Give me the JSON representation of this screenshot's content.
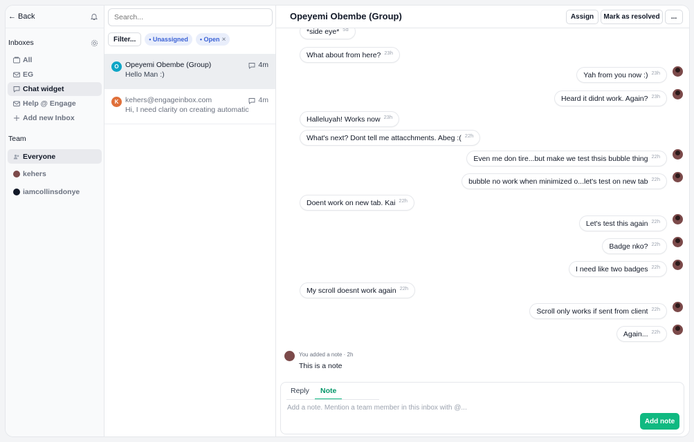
{
  "sidebar": {
    "back_label": "← Back",
    "inboxes_heading": "Inboxes",
    "inbox_items": [
      {
        "label": "All",
        "icon": "inbox-stack-icon"
      },
      {
        "label": "EG",
        "icon": "mail-icon"
      },
      {
        "label": "Chat widget",
        "icon": "chat-icon",
        "active": true
      },
      {
        "label": "Help @ Engage",
        "icon": "mail-icon"
      },
      {
        "label": "Add new Inbox",
        "icon": "plus-icon"
      }
    ],
    "team_heading": "Team",
    "team_items": [
      {
        "label": "Everyone",
        "icon": "users-icon",
        "active": true
      },
      {
        "label": "kehers",
        "icon": "avatar"
      },
      {
        "label": "iamcollinsdonye",
        "icon": "avatar"
      }
    ]
  },
  "conversations": {
    "search_placeholder": "Search...",
    "filter_label": "Filter...",
    "chips": [
      "• Unassigned",
      "• Open"
    ],
    "chip_close": "×",
    "items": [
      {
        "initial": "O",
        "name": "Opeyemi Obembe (Group)",
        "preview": "Hello Man :)",
        "time": "4m",
        "color": "#0ea5c6"
      },
      {
        "initial": "K",
        "name": "kehers@engageinbox.com",
        "preview": "Hi, I need clarity on creating automations",
        "time": "4m",
        "color": "#e0703a"
      }
    ]
  },
  "main": {
    "title": "Opeyemi Obembe (Group)",
    "assign_label": "Assign",
    "resolve_label": "Mark as resolved",
    "more_label": "...",
    "messages": [
      {
        "dir": "in",
        "text": "*side eye*",
        "time": "5d"
      },
      {
        "dir": "in",
        "text": "What about from here?",
        "time": "23h"
      },
      {
        "dir": "out",
        "text": "Yah from you now :)",
        "time": "23h"
      },
      {
        "dir": "out",
        "text": "Heard it didnt work. Again?",
        "time": "23h"
      },
      {
        "dir": "in",
        "text": "Halleluyah! Works now",
        "time": "23h"
      },
      {
        "dir": "in",
        "text": "What's next? Dont tell me attacchments. Abeg :(",
        "time": "22h"
      },
      {
        "dir": "out",
        "text": "Even me don tire...but make we test thsis bubble thing",
        "time": "22h"
      },
      {
        "dir": "out",
        "text": "bubble no work when minimized o...let's test on new tab",
        "time": "22h"
      },
      {
        "dir": "in",
        "text": "Doent work on new tab. Kai",
        "time": "22h"
      },
      {
        "dir": "out",
        "text": "Let's test this again",
        "time": "22h"
      },
      {
        "dir": "out",
        "text": "Badge nko?",
        "time": "22h"
      },
      {
        "dir": "out",
        "text": "I need like two badges",
        "time": "22h"
      },
      {
        "dir": "in",
        "text": "My scroll doesnt work again",
        "time": "22h"
      },
      {
        "dir": "out",
        "text": "Scroll only works if sent from client",
        "time": "22h"
      },
      {
        "dir": "out",
        "text": "Again...",
        "time": "22h"
      }
    ],
    "note": {
      "meta": "You added a note · 2h",
      "text": "This is a note"
    },
    "composer": {
      "reply_tab": "Reply",
      "note_tab": "Note",
      "placeholder": "Add a note. Mention a team member in this inbox with @...",
      "submit_label": "Add note"
    }
  },
  "colors": {
    "accent": "#10b981",
    "chip_text": "#3b62d6"
  }
}
